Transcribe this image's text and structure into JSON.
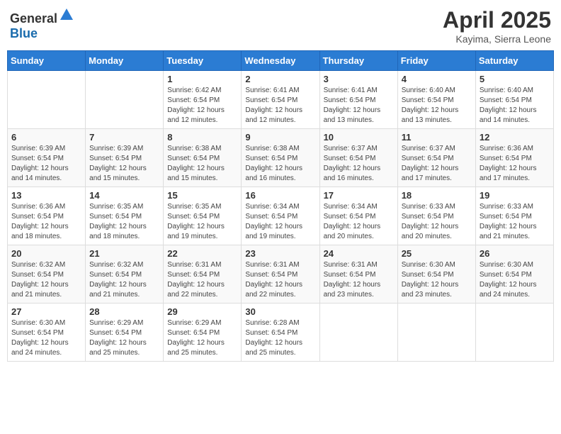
{
  "header": {
    "logo_general": "General",
    "logo_blue": "Blue",
    "month": "April 2025",
    "location": "Kayima, Sierra Leone"
  },
  "days_of_week": [
    "Sunday",
    "Monday",
    "Tuesday",
    "Wednesday",
    "Thursday",
    "Friday",
    "Saturday"
  ],
  "weeks": [
    [
      {
        "day": "",
        "sunrise": "",
        "sunset": "",
        "daylight": ""
      },
      {
        "day": "",
        "sunrise": "",
        "sunset": "",
        "daylight": ""
      },
      {
        "day": "1",
        "sunrise": "Sunrise: 6:42 AM",
        "sunset": "Sunset: 6:54 PM",
        "daylight": "Daylight: 12 hours and 12 minutes."
      },
      {
        "day": "2",
        "sunrise": "Sunrise: 6:41 AM",
        "sunset": "Sunset: 6:54 PM",
        "daylight": "Daylight: 12 hours and 12 minutes."
      },
      {
        "day": "3",
        "sunrise": "Sunrise: 6:41 AM",
        "sunset": "Sunset: 6:54 PM",
        "daylight": "Daylight: 12 hours and 13 minutes."
      },
      {
        "day": "4",
        "sunrise": "Sunrise: 6:40 AM",
        "sunset": "Sunset: 6:54 PM",
        "daylight": "Daylight: 12 hours and 13 minutes."
      },
      {
        "day": "5",
        "sunrise": "Sunrise: 6:40 AM",
        "sunset": "Sunset: 6:54 PM",
        "daylight": "Daylight: 12 hours and 14 minutes."
      }
    ],
    [
      {
        "day": "6",
        "sunrise": "Sunrise: 6:39 AM",
        "sunset": "Sunset: 6:54 PM",
        "daylight": "Daylight: 12 hours and 14 minutes."
      },
      {
        "day": "7",
        "sunrise": "Sunrise: 6:39 AM",
        "sunset": "Sunset: 6:54 PM",
        "daylight": "Daylight: 12 hours and 15 minutes."
      },
      {
        "day": "8",
        "sunrise": "Sunrise: 6:38 AM",
        "sunset": "Sunset: 6:54 PM",
        "daylight": "Daylight: 12 hours and 15 minutes."
      },
      {
        "day": "9",
        "sunrise": "Sunrise: 6:38 AM",
        "sunset": "Sunset: 6:54 PM",
        "daylight": "Daylight: 12 hours and 16 minutes."
      },
      {
        "day": "10",
        "sunrise": "Sunrise: 6:37 AM",
        "sunset": "Sunset: 6:54 PM",
        "daylight": "Daylight: 12 hours and 16 minutes."
      },
      {
        "day": "11",
        "sunrise": "Sunrise: 6:37 AM",
        "sunset": "Sunset: 6:54 PM",
        "daylight": "Daylight: 12 hours and 17 minutes."
      },
      {
        "day": "12",
        "sunrise": "Sunrise: 6:36 AM",
        "sunset": "Sunset: 6:54 PM",
        "daylight": "Daylight: 12 hours and 17 minutes."
      }
    ],
    [
      {
        "day": "13",
        "sunrise": "Sunrise: 6:36 AM",
        "sunset": "Sunset: 6:54 PM",
        "daylight": "Daylight: 12 hours and 18 minutes."
      },
      {
        "day": "14",
        "sunrise": "Sunrise: 6:35 AM",
        "sunset": "Sunset: 6:54 PM",
        "daylight": "Daylight: 12 hours and 18 minutes."
      },
      {
        "day": "15",
        "sunrise": "Sunrise: 6:35 AM",
        "sunset": "Sunset: 6:54 PM",
        "daylight": "Daylight: 12 hours and 19 minutes."
      },
      {
        "day": "16",
        "sunrise": "Sunrise: 6:34 AM",
        "sunset": "Sunset: 6:54 PM",
        "daylight": "Daylight: 12 hours and 19 minutes."
      },
      {
        "day": "17",
        "sunrise": "Sunrise: 6:34 AM",
        "sunset": "Sunset: 6:54 PM",
        "daylight": "Daylight: 12 hours and 20 minutes."
      },
      {
        "day": "18",
        "sunrise": "Sunrise: 6:33 AM",
        "sunset": "Sunset: 6:54 PM",
        "daylight": "Daylight: 12 hours and 20 minutes."
      },
      {
        "day": "19",
        "sunrise": "Sunrise: 6:33 AM",
        "sunset": "Sunset: 6:54 PM",
        "daylight": "Daylight: 12 hours and 21 minutes."
      }
    ],
    [
      {
        "day": "20",
        "sunrise": "Sunrise: 6:32 AM",
        "sunset": "Sunset: 6:54 PM",
        "daylight": "Daylight: 12 hours and 21 minutes."
      },
      {
        "day": "21",
        "sunrise": "Sunrise: 6:32 AM",
        "sunset": "Sunset: 6:54 PM",
        "daylight": "Daylight: 12 hours and 21 minutes."
      },
      {
        "day": "22",
        "sunrise": "Sunrise: 6:31 AM",
        "sunset": "Sunset: 6:54 PM",
        "daylight": "Daylight: 12 hours and 22 minutes."
      },
      {
        "day": "23",
        "sunrise": "Sunrise: 6:31 AM",
        "sunset": "Sunset: 6:54 PM",
        "daylight": "Daylight: 12 hours and 22 minutes."
      },
      {
        "day": "24",
        "sunrise": "Sunrise: 6:31 AM",
        "sunset": "Sunset: 6:54 PM",
        "daylight": "Daylight: 12 hours and 23 minutes."
      },
      {
        "day": "25",
        "sunrise": "Sunrise: 6:30 AM",
        "sunset": "Sunset: 6:54 PM",
        "daylight": "Daylight: 12 hours and 23 minutes."
      },
      {
        "day": "26",
        "sunrise": "Sunrise: 6:30 AM",
        "sunset": "Sunset: 6:54 PM",
        "daylight": "Daylight: 12 hours and 24 minutes."
      }
    ],
    [
      {
        "day": "27",
        "sunrise": "Sunrise: 6:30 AM",
        "sunset": "Sunset: 6:54 PM",
        "daylight": "Daylight: 12 hours and 24 minutes."
      },
      {
        "day": "28",
        "sunrise": "Sunrise: 6:29 AM",
        "sunset": "Sunset: 6:54 PM",
        "daylight": "Daylight: 12 hours and 25 minutes."
      },
      {
        "day": "29",
        "sunrise": "Sunrise: 6:29 AM",
        "sunset": "Sunset: 6:54 PM",
        "daylight": "Daylight: 12 hours and 25 minutes."
      },
      {
        "day": "30",
        "sunrise": "Sunrise: 6:28 AM",
        "sunset": "Sunset: 6:54 PM",
        "daylight": "Daylight: 12 hours and 25 minutes."
      },
      {
        "day": "",
        "sunrise": "",
        "sunset": "",
        "daylight": ""
      },
      {
        "day": "",
        "sunrise": "",
        "sunset": "",
        "daylight": ""
      },
      {
        "day": "",
        "sunrise": "",
        "sunset": "",
        "daylight": ""
      }
    ]
  ]
}
